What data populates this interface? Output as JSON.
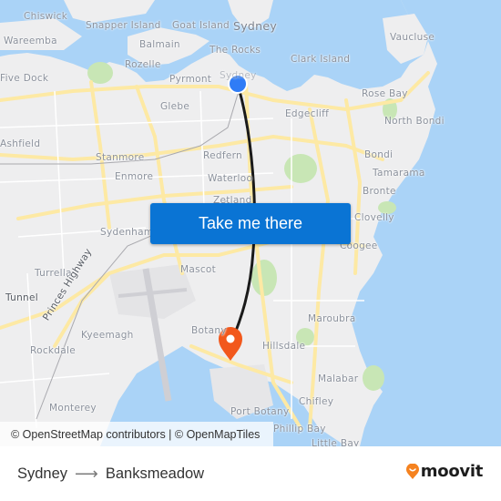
{
  "map": {
    "cta_label": "Take me there",
    "attribution": "© OpenStreetMap contributors | © OpenMapTiles",
    "origin_marker_color": "#2f7cf6",
    "destination_marker_color": "#f2581c",
    "route_color": "#1a1a1a",
    "colors": {
      "water": "#aad3f7",
      "land": "#eeeeef",
      "road": "#fde9a4",
      "park": "#c8e6b5",
      "button": "#0a74d4"
    },
    "places": [
      {
        "id": "chiswick",
        "label": "Chiswick"
      },
      {
        "id": "snapper-island",
        "label": "Snapper Island"
      },
      {
        "id": "goat-island",
        "label": "Goat Island"
      },
      {
        "id": "sydney",
        "label": "Sydney"
      },
      {
        "id": "wareemba",
        "label": "Wareemba"
      },
      {
        "id": "balmain",
        "label": "Balmain"
      },
      {
        "id": "the-rocks",
        "label": "The Rocks"
      },
      {
        "id": "clark-island",
        "label": "Clark Island"
      },
      {
        "id": "vaucluse",
        "label": "Vaucluse"
      },
      {
        "id": "rozelle",
        "label": "Rozelle"
      },
      {
        "id": "five-dock",
        "label": "Five Dock"
      },
      {
        "id": "pyrmont",
        "label": "Pyrmont"
      },
      {
        "id": "sydney-cbd",
        "label": "Sydney"
      },
      {
        "id": "rose-bay",
        "label": "Rose Bay"
      },
      {
        "id": "glebe",
        "label": "Glebe"
      },
      {
        "id": "edgecliff",
        "label": "Edgecliff"
      },
      {
        "id": "north-bondi",
        "label": "North Bondi"
      },
      {
        "id": "ashfield",
        "label": "Ashfield"
      },
      {
        "id": "stanmore",
        "label": "Stanmore"
      },
      {
        "id": "redfern",
        "label": "Redfern"
      },
      {
        "id": "bondi",
        "label": "Bondi"
      },
      {
        "id": "tamarama",
        "label": "Tamarama"
      },
      {
        "id": "enmore",
        "label": "Enmore"
      },
      {
        "id": "waterloo",
        "label": "Waterloo"
      },
      {
        "id": "bronte",
        "label": "Bronte"
      },
      {
        "id": "zetland",
        "label": "Zetland"
      },
      {
        "id": "clovelly",
        "label": "Clovelly"
      },
      {
        "id": "sydenham",
        "label": "Sydenham"
      },
      {
        "id": "coogee",
        "label": "Coogee"
      },
      {
        "id": "turrella",
        "label": "Turrella"
      },
      {
        "id": "mascot",
        "label": "Mascot"
      },
      {
        "id": "tunnel",
        "label": "Tunnel"
      },
      {
        "id": "princes-highway",
        "label": "Princes Highway"
      },
      {
        "id": "maroubra",
        "label": "Maroubra"
      },
      {
        "id": "kyeemagh",
        "label": "Kyeemagh"
      },
      {
        "id": "botany",
        "label": "Botany"
      },
      {
        "id": "hillsdale",
        "label": "Hillsdale"
      },
      {
        "id": "rockdale",
        "label": "Rockdale"
      },
      {
        "id": "malabar",
        "label": "Malabar"
      },
      {
        "id": "chifley",
        "label": "Chifley"
      },
      {
        "id": "monterey",
        "label": "Monterey"
      },
      {
        "id": "port-botany",
        "label": "Port Botany"
      },
      {
        "id": "phillip-bay",
        "label": "Phillip Bay"
      },
      {
        "id": "little-bay",
        "label": "Little Bay"
      }
    ]
  },
  "footer": {
    "origin": "Sydney",
    "arrow": "⟶",
    "destination": "Banksmeadow",
    "logo_text": "moovit",
    "logo_color": "#f5821f"
  }
}
